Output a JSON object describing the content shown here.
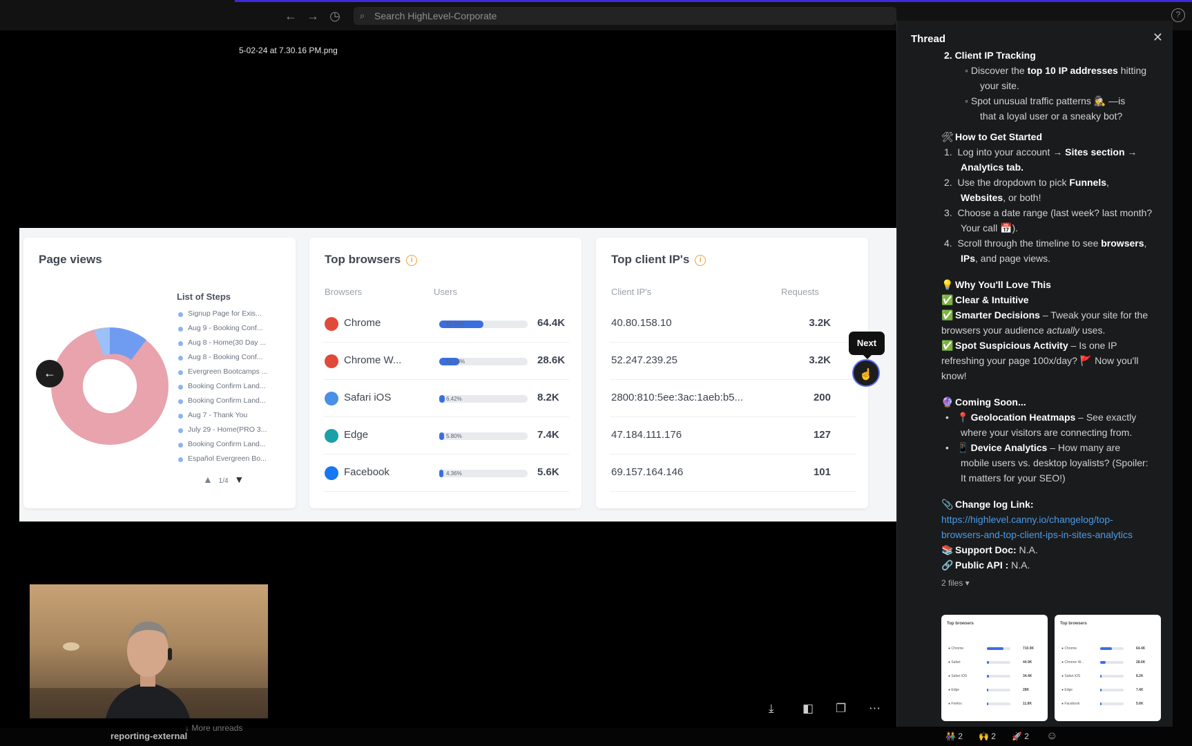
{
  "topbar": {
    "search_placeholder": "Search HighLevel-Corporate",
    "back_icon": "←",
    "forward_icon": "→",
    "history_icon": "◷",
    "help_icon": "?"
  },
  "viewer": {
    "filename": "5-02-24 at 7.30.16 PM.png",
    "tooltip": "Next",
    "prev_icon": "←"
  },
  "slide": {
    "page_views": {
      "title": "Page views",
      "legend_title": "List of Steps",
      "legend_items": [
        "Signup Page for Exis...",
        "Aug 9 - Booking Conf...",
        "Aug 8 - Home(30 Day ...",
        "Aug 8 - Booking Conf...",
        "Evergreen Bootcamps ...",
        "Booking Confirm Land...",
        "Booking Confirm Land...",
        "Aug 7 - Thank You",
        "July 29 - Home(PRO 3...",
        "Booking Confirm Land...",
        "Español Evergreen Bo..."
      ],
      "pager": "1/4"
    },
    "top_browsers": {
      "title": "Top browsers",
      "col_browsers": "Browsers",
      "col_users": "Users",
      "rows": [
        {
          "name": "Chrome",
          "pct": "50.20%",
          "fill": 0.5,
          "value": "64.4K",
          "color": "#e04a3a"
        },
        {
          "name": "Chrome W...",
          "pct": "23.33%",
          "fill": 0.23,
          "value": "28.6K",
          "color": "#e04a3a"
        },
        {
          "name": "Safari iOS",
          "pct": "6.42%",
          "fill": 0.064,
          "value": "8.2K",
          "color": "#4a8fe8"
        },
        {
          "name": "Edge",
          "pct": "5.80%",
          "fill": 0.058,
          "value": "7.4K",
          "color": "#1aa0a8"
        },
        {
          "name": "Facebook",
          "pct": "4.36%",
          "fill": 0.044,
          "value": "5.6K",
          "color": "#1877f2"
        }
      ]
    },
    "top_ips": {
      "title": "Top client IP's",
      "col_ip": "Client IP's",
      "col_requests": "Requests",
      "rows": [
        {
          "ip": "40.80.158.10",
          "requests": "3.2K"
        },
        {
          "ip": "52.247.239.25",
          "requests": "3.2K"
        },
        {
          "ip": "2800:810:5ee:3ac:1aeb:b5...",
          "requests": "200"
        },
        {
          "ip": "47.184.111.176",
          "requests": "127"
        },
        {
          "ip": "69.157.164.146",
          "requests": "101"
        }
      ]
    }
  },
  "bottom": {
    "more_unreads": "↓ More unreads",
    "channel": "reporting-external"
  },
  "thread": {
    "title": "Thread",
    "lines": {
      "l1": "2.  Client IP Tracking",
      "l2a": "Discover the ",
      "l2b": "top 10 IP addresses",
      "l2c": " hitting",
      "l3": "your site.",
      "l4": "Spot unusual traffic patterns 🕵️‍♀️ —is",
      "l5": "that a loyal user or a sneaky bot?",
      "l6": "How to Get Started",
      "l7a": "Log into your account → ",
      "l7b": "Sites section",
      "l7c": " →",
      "l8": "Analytics tab.",
      "l9a": "Use the dropdown to pick ",
      "l9b": "Funnels",
      "l10b": "Websites",
      "l10c": ", or both!",
      "l11": "Choose a date range (last week? last month?",
      "l12": "Your call 📅).",
      "l13a": "Scroll through the timeline to see ",
      "l13b": "browsers",
      "l14b": "IPs",
      "l14c": ", and page views.",
      "l15": "Why You'll Love This",
      "l16": "Clear & Intuitive",
      "l17a": "Smarter Decisions",
      "l17b": " – Tweak your site for the",
      "l18a": "browsers your audience ",
      "l18b": "actually",
      "l18c": " uses.",
      "l19a": "Spot Suspicious Activity",
      "l19b": " – Is one IP",
      "l20": "refreshing your page 100x/day? 🚩 Now you'll",
      "l21": "know!",
      "l22": "Coming Soon...",
      "l23a": "Geolocation Heatmaps",
      "l23b": " – See exactly",
      "l24": "where your visitors are connecting from.",
      "l25a": "Device Analytics",
      "l25b": " – How many are",
      "l26": "mobile users vs. desktop loyalists? (Spoiler:",
      "l27": "It matters for your SEO!)",
      "l28": "Change log Link:",
      "l29": "https://highlevel.canny.io/changelog/top-",
      "l30": "browsers-and-top-client-ips-in-sites-analytics",
      "l31a": "Support Doc:",
      "l31b": " N.A.",
      "l32a": "Public API :",
      "l32b": " N.A.",
      "l33": "2 files ▾"
    },
    "reactions": [
      {
        "emoji": "👫",
        "count": "2"
      },
      {
        "emoji": "🙌",
        "count": "2"
      },
      {
        "emoji": "🚀",
        "count": "2"
      }
    ]
  }
}
